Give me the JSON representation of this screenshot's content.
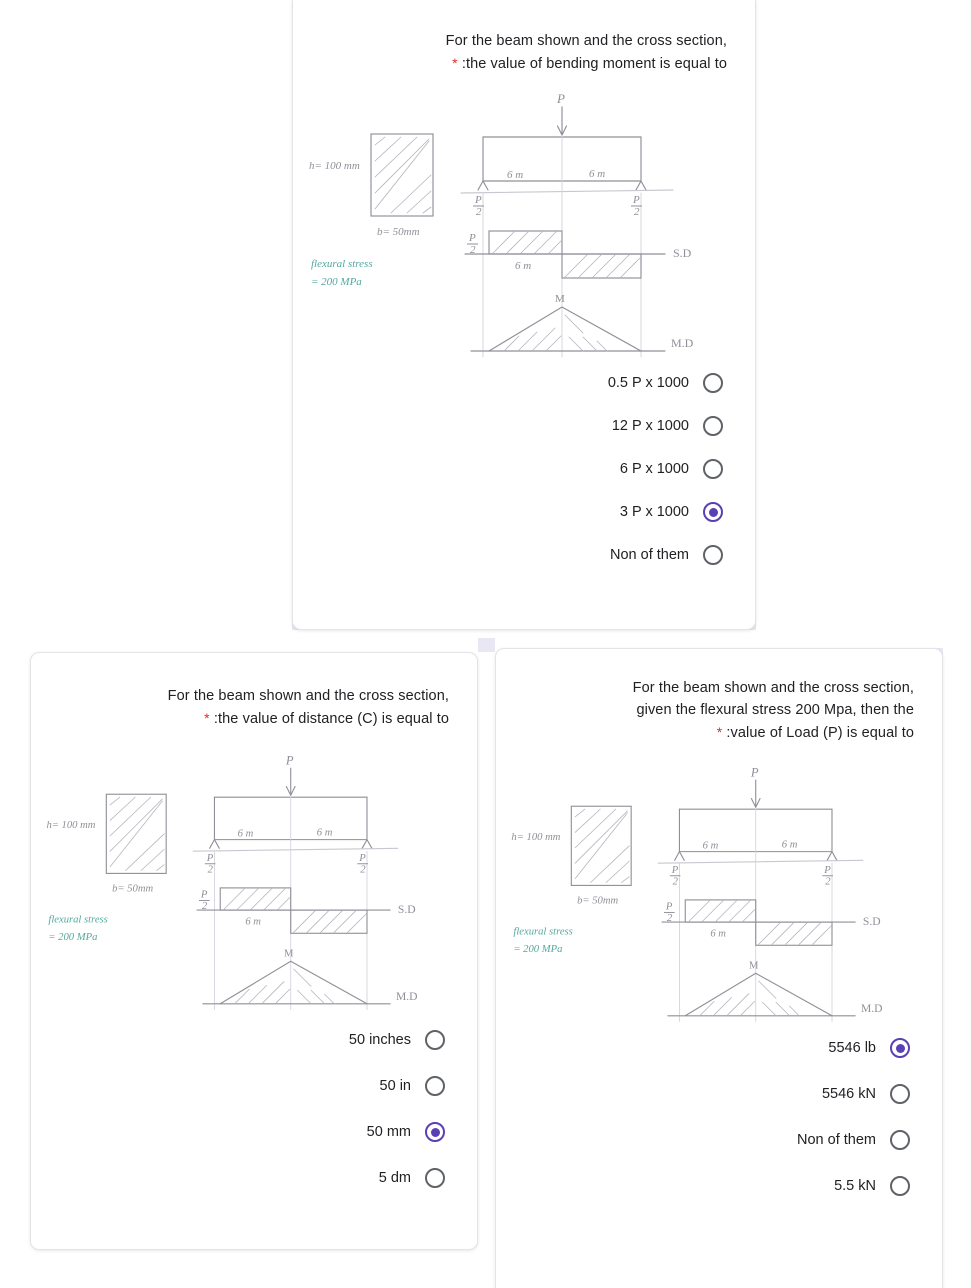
{
  "page": {
    "background": "#ffffff",
    "accent_selected": "#5b3fb5",
    "required_marker": "*",
    "strip_color": "#e9e7f3"
  },
  "diagram": {
    "alt": "hand-drawn beam diagram with cross section, shear force diagram and bending moment diagram",
    "labels": {
      "height": "h= 100 mm",
      "width": "b= 50mm",
      "note_line1": "flexural stress",
      "note_line2": "= 200 MPa",
      "load": "P",
      "span_left": "6 m",
      "span_right": "6 m",
      "reaction_left": "P/2",
      "reaction_right": "P/2",
      "shear_value": "P/2",
      "shear_span": "6 m",
      "shear_title": "S.D",
      "moment_peak": "M",
      "moment_title": "M.D"
    },
    "note_color": "#4a9b96",
    "ink_color": "#8a8a93"
  },
  "questions": [
    {
      "id": "q-bending-moment",
      "line1": "For the beam shown and the cross section,",
      "line2": ":the value of bending moment is equal to",
      "options": [
        {
          "label": "0.5 P x 1000",
          "selected": false
        },
        {
          "label": "12 P x 1000",
          "selected": false
        },
        {
          "label": "6 P x 1000",
          "selected": false
        },
        {
          "label": "3 P x 1000",
          "selected": true
        },
        {
          "label": "Non of them",
          "selected": false
        }
      ]
    },
    {
      "id": "q-distance-c",
      "line1": "For the beam shown and the cross section,",
      "line2": ":the value of distance (C) is equal to",
      "options": [
        {
          "label": "50 inches",
          "selected": false
        },
        {
          "label": "50 in",
          "selected": false
        },
        {
          "label": "50 mm",
          "selected": true
        },
        {
          "label": "5 dm",
          "selected": false
        }
      ]
    },
    {
      "id": "q-load-p",
      "line1": "For the beam shown and the cross section,",
      "line2": "given the flexural stress 200 Mpa, then the",
      "line3": ":value of Load (P) is equal to",
      "options": [
        {
          "label": "5546 lb",
          "selected": true
        },
        {
          "label": "5546 kN",
          "selected": false
        },
        {
          "label": "Non of them",
          "selected": false
        },
        {
          "label": "5.5 kN",
          "selected": false
        }
      ]
    }
  ]
}
